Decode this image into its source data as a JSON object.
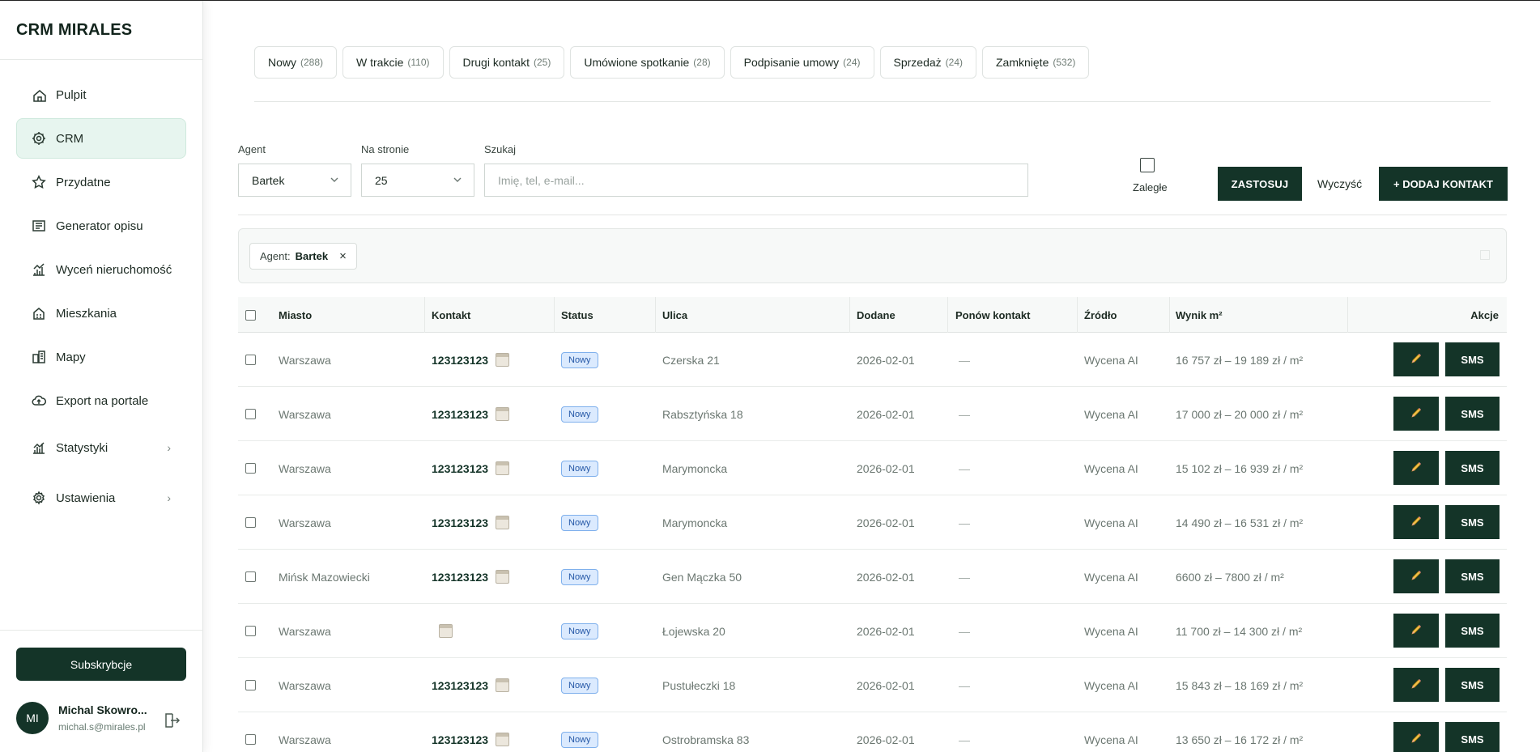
{
  "app": {
    "brand": "CRM MIRALES"
  },
  "sidebar": {
    "items": [
      {
        "label": "Pulpit",
        "icon": "home-icon"
      },
      {
        "label": "CRM",
        "icon": "crm-icon",
        "active": true
      },
      {
        "label": "Przydatne",
        "icon": "star-icon"
      },
      {
        "label": "Generator opisu",
        "icon": "document-icon"
      },
      {
        "label": "Wyceń nieruchomość",
        "icon": "chart-icon"
      },
      {
        "label": "Mieszkania",
        "icon": "building-icon"
      },
      {
        "label": "Mapy",
        "icon": "map-icon"
      },
      {
        "label": "Export na portale",
        "icon": "cloud-upload-icon"
      },
      {
        "label": "Statystyki",
        "icon": "stats-icon",
        "chevron": "›"
      },
      {
        "label": "Ustawienia",
        "icon": "gear-icon",
        "chevron": "›"
      }
    ],
    "subscribe_label": "Subskrybcje",
    "user": {
      "initials": "MI",
      "name": "Michal Skowro...",
      "email": "michal.s@mirales.pl"
    }
  },
  "tabs": [
    {
      "label": "Nowy",
      "count": "(288)"
    },
    {
      "label": "W trakcie",
      "count": "(110)"
    },
    {
      "label": "Drugi kontakt",
      "count": "(25)"
    },
    {
      "label": "Umówione spotkanie",
      "count": "(28)"
    },
    {
      "label": "Podpisanie umowy",
      "count": "(24)"
    },
    {
      "label": "Sprzedaż",
      "count": "(24)"
    },
    {
      "label": "Zamknięte",
      "count": "(532)"
    }
  ],
  "filters": {
    "agent_label": "Agent",
    "agent_value": "Bartek",
    "per_page_label": "Na stronie",
    "per_page_value": "25",
    "search_label": "Szukaj",
    "search_placeholder": "Imię, tel, e-mail...",
    "overdue_label": "Zaległe",
    "apply_label": "ZASTOSUJ",
    "clear_label": "Wyczyść",
    "add_label": "+ DODAJ KONTAKT"
  },
  "chip": {
    "key": "Agent:",
    "value": "Bartek",
    "remove": "×"
  },
  "table": {
    "headers": {
      "city": "Miasto",
      "contact": "Kontakt",
      "status": "Status",
      "street": "Ulica",
      "added": "Dodane",
      "recontact": "Ponów kontakt",
      "source": "Źródło",
      "result": "Wynik m²",
      "actions": "Akcje"
    },
    "rows": [
      {
        "city": "Warszawa",
        "contact": "123123123",
        "status": "Nowy",
        "street": "Czerska 21",
        "added": "2026-02-01",
        "recontact": "—",
        "source": "Wycena AI",
        "result": "16 757 zł – 19 189 zł / m²",
        "sms": "SMS"
      },
      {
        "city": "Warszawa",
        "contact": "123123123",
        "status": "Nowy",
        "street": "Rabsztyńska 18",
        "added": "2026-02-01",
        "recontact": "—",
        "source": "Wycena AI",
        "result": "17 000 zł – 20 000 zł / m²",
        "sms": "SMS"
      },
      {
        "city": "Warszawa",
        "contact": "123123123",
        "status": "Nowy",
        "street": "Marymoncka",
        "added": "2026-02-01",
        "recontact": "—",
        "source": "Wycena AI",
        "result": "15 102 zł – 16 939 zł / m²",
        "sms": "SMS"
      },
      {
        "city": "Warszawa",
        "contact": "123123123",
        "status": "Nowy",
        "street": "Marymoncka",
        "added": "2026-02-01",
        "recontact": "—",
        "source": "Wycena AI",
        "result": "14 490 zł – 16 531 zł / m²",
        "sms": "SMS"
      },
      {
        "city": "Mińsk Mazowiecki",
        "contact": "123123123",
        "status": "Nowy",
        "street": "Gen Mączka 50",
        "added": "2026-02-01",
        "recontact": "—",
        "source": "Wycena AI",
        "result": "6600 zł – 7800 zł / m²",
        "sms": "SMS"
      },
      {
        "city": "Warszawa",
        "contact": "",
        "status": "Nowy",
        "street": "Łojewska 20",
        "added": "2026-02-01",
        "recontact": "—",
        "source": "Wycena AI",
        "result": "11 700 zł – 14 300 zł / m²",
        "sms": "SMS"
      },
      {
        "city": "Warszawa",
        "contact": "123123123",
        "status": "Nowy",
        "street": "Pustułeczki 18",
        "added": "2026-02-01",
        "recontact": "—",
        "source": "Wycena AI",
        "result": "15 843 zł – 18 169 zł / m²",
        "sms": "SMS"
      },
      {
        "city": "Warszawa",
        "contact": "123123123",
        "status": "Nowy",
        "street": "Ostrobramska 83",
        "added": "2026-02-01",
        "recontact": "—",
        "source": "Wycena AI",
        "result": "13 650 zł – 16 172 zł / m²",
        "sms": "SMS"
      }
    ]
  },
  "colors": {
    "primary": "#143428",
    "active_bg": "#e7f5ef",
    "badge_bg": "#dbeafe",
    "badge_text": "#2457a6"
  }
}
